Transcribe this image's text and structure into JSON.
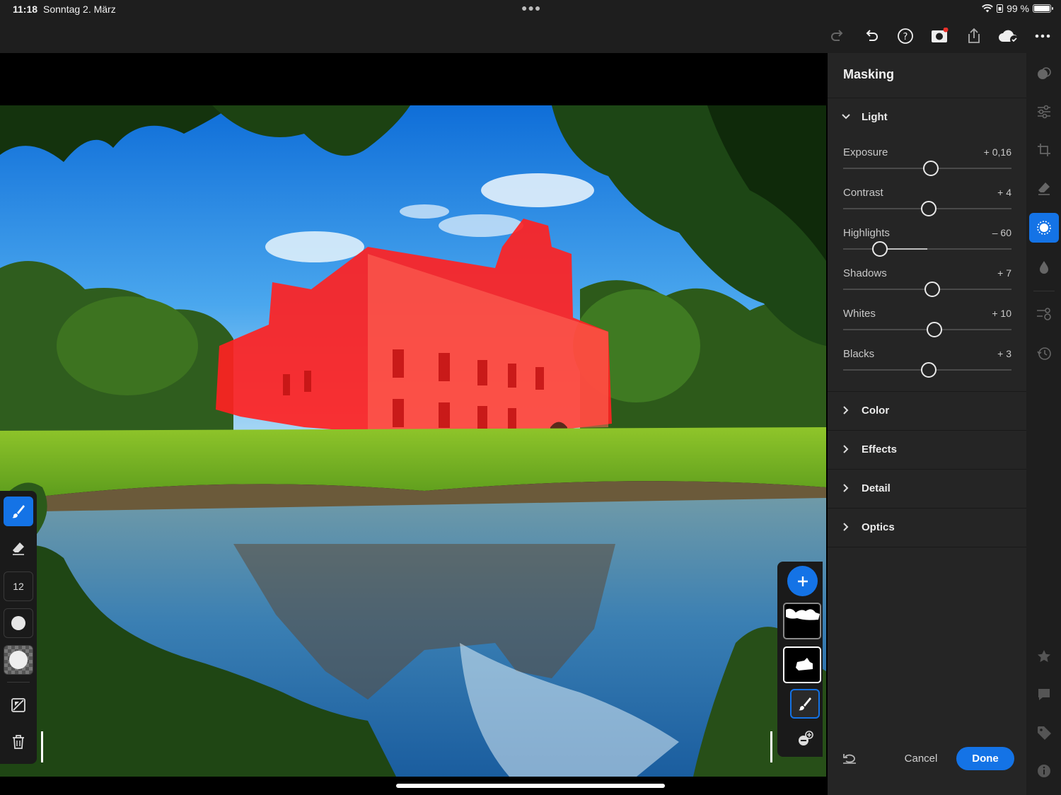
{
  "status": {
    "time": "11:18",
    "date": "Sonntag 2. März",
    "battery": "99 %"
  },
  "toolbar": {
    "icons": [
      "redo-icon",
      "undo-icon",
      "help-icon",
      "camera-icon",
      "share-icon",
      "cloud-sync-icon",
      "more-icon"
    ]
  },
  "brush_tools": {
    "size": "12"
  },
  "panel": {
    "title": "Masking",
    "sections": {
      "light": "Light",
      "color": "Color",
      "effects": "Effects",
      "detail": "Detail",
      "optics": "Optics"
    },
    "sliders": [
      {
        "label": "Exposure",
        "value": "+ 0,16",
        "level": 0.52
      },
      {
        "label": "Contrast",
        "value": "+ 4",
        "level": 0.51
      },
      {
        "label": "Highlights",
        "value": "– 60",
        "level": 0.22
      },
      {
        "label": "Shadows",
        "value": "+ 7",
        "level": 0.53
      },
      {
        "label": "Whites",
        "value": "+ 10",
        "level": 0.54
      },
      {
        "label": "Blacks",
        "value": "+ 3",
        "level": 0.51
      }
    ],
    "cancel": "Cancel",
    "done": "Done"
  },
  "colors": {
    "accent": "#1473e6",
    "mask_overlay": "#ff1a1a",
    "panel_bg": "#252525"
  }
}
